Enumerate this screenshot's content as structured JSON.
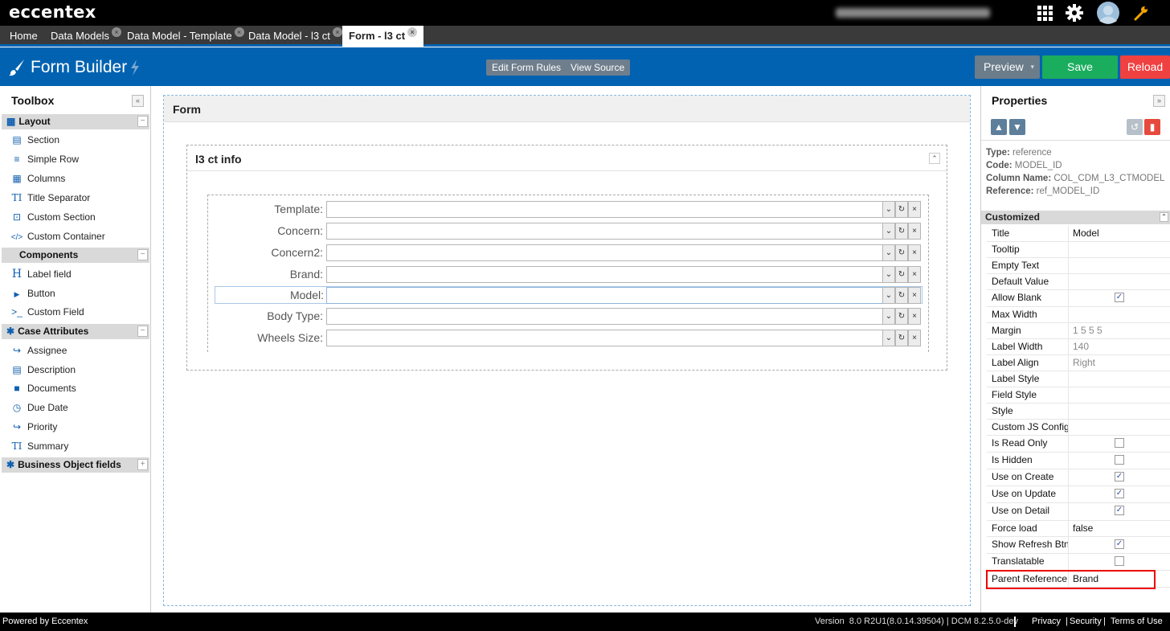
{
  "topbar": {
    "logo": "eccentex"
  },
  "tabs": [
    {
      "label": "Home"
    },
    {
      "label": "Data Models",
      "close": "×"
    },
    {
      "label": "Data Model - Template",
      "close": "×"
    },
    {
      "label": "Data Model - l3 ct",
      "close": "×"
    },
    {
      "label": "Form - l3 ct",
      "close": "×"
    }
  ],
  "header": {
    "title": "Form Builder",
    "edit_rules": "Edit Form Rules",
    "view_source": "View Source",
    "preview": "Preview",
    "save": "Save",
    "reload": "Reload",
    "colors": {
      "brand": "#0062b1",
      "save": "#1aad5e",
      "reload": "#f04141",
      "preview": "#6b7c8a"
    }
  },
  "toolbox": {
    "title": "Toolbox",
    "groups": [
      {
        "label": "Layout",
        "items": [
          "Section",
          "Simple Row",
          "Columns",
          "Title Separator",
          "Custom Section",
          "Custom Container"
        ]
      },
      {
        "label": "Components",
        "items": [
          "Label field",
          "Button",
          "Custom Field"
        ]
      },
      {
        "label": "Case Attributes",
        "items": [
          "Assignee",
          "Description",
          "Documents",
          "Due Date",
          "Priority",
          "Summary"
        ]
      },
      {
        "label": "Business Object fields",
        "items": []
      }
    ]
  },
  "canvas": {
    "form_title": "Form",
    "section_title": "l3 ct info",
    "fields": [
      {
        "label": "Template:"
      },
      {
        "label": "Concern:"
      },
      {
        "label": "Concern2:"
      },
      {
        "label": "Brand:"
      },
      {
        "label": "Model:"
      },
      {
        "label": "Body Type:"
      },
      {
        "label": "Wheels Size:"
      }
    ]
  },
  "properties": {
    "title": "Properties",
    "info": {
      "type_label": "Type:",
      "type": "reference",
      "code_label": "Code:",
      "code": "MODEL_ID",
      "column_label": "Column Name:",
      "column": "COL_CDM_L3_CTMODEL",
      "reference_label": "Reference:",
      "reference": "ref_MODEL_ID"
    },
    "section": "Customized",
    "rows": [
      {
        "key": "Title",
        "value": "Model"
      },
      {
        "key": "Tooltip",
        "value": ""
      },
      {
        "key": "Empty Text",
        "value": ""
      },
      {
        "key": "Default Value",
        "value": ""
      },
      {
        "key": "Allow Blank",
        "check": true
      },
      {
        "key": "Max Width",
        "value": ""
      },
      {
        "key": "Margin",
        "value": "1 5 5 5"
      },
      {
        "key": "Label Width",
        "value": "140"
      },
      {
        "key": "Label Align",
        "value": "Right"
      },
      {
        "key": "Label Style",
        "value": ""
      },
      {
        "key": "Field Style",
        "value": ""
      },
      {
        "key": "Style",
        "value": ""
      },
      {
        "key": "Custom JS Config",
        "value": ""
      },
      {
        "key": "Is Read Only",
        "check": false
      },
      {
        "key": "Is Hidden",
        "check": false
      },
      {
        "key": "Use on Create",
        "check": true
      },
      {
        "key": "Use on Update",
        "check": true
      },
      {
        "key": "Use on Detail",
        "check": true
      },
      {
        "key": "Force load",
        "value": "false"
      },
      {
        "key": "Show Refresh Btn",
        "check": true
      },
      {
        "key": "Translatable",
        "check": false
      },
      {
        "key": "Parent Reference",
        "value": "Brand"
      }
    ]
  },
  "footer": {
    "powered": "Powered by Eccentex",
    "version": "Version  8.0 R2U1(8.0.14.39504) | DCM 8.2.5.0-dev",
    "privacy": "Privacy",
    "security": "Security",
    "terms": "Terms of Use"
  }
}
